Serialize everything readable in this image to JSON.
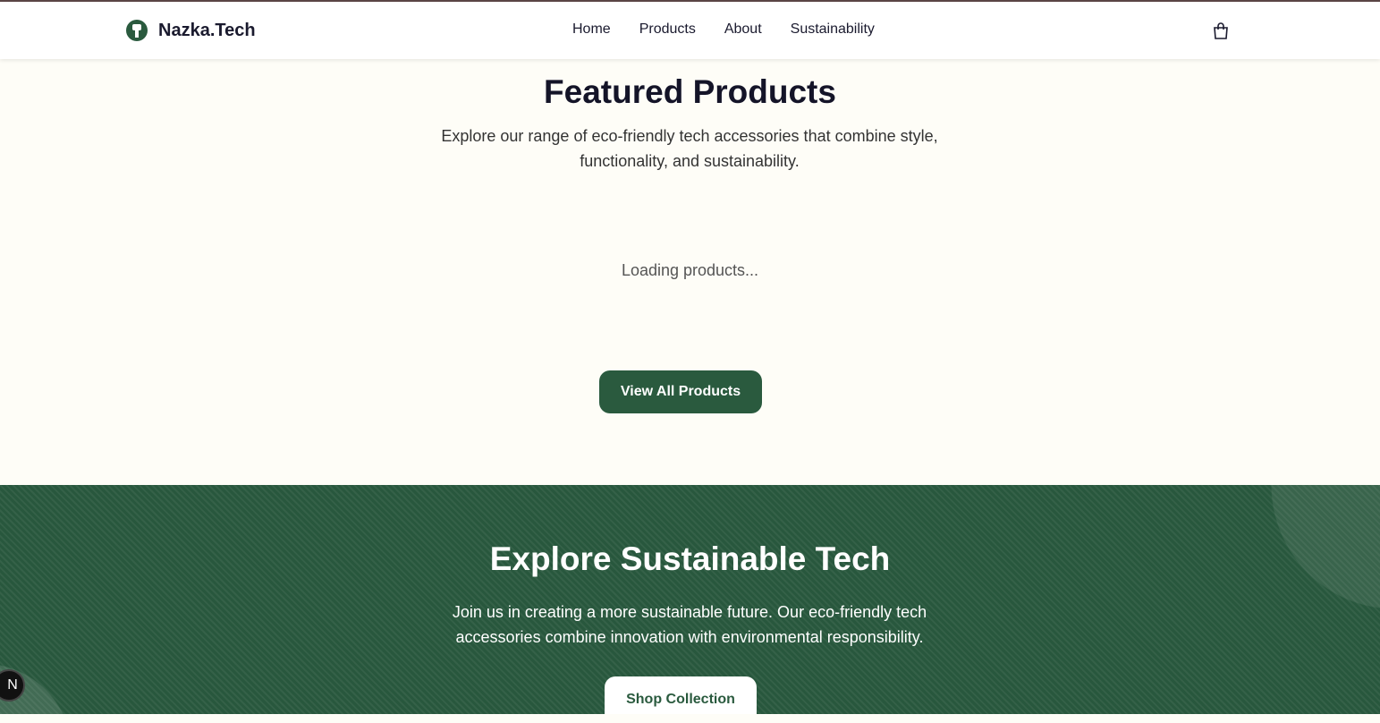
{
  "header": {
    "brand": "Nazka.Tech",
    "nav": [
      "Home",
      "Products",
      "About",
      "Sustainability"
    ]
  },
  "featured": {
    "title": "Featured Products",
    "subtitle": "Explore our range of eco-friendly tech accessories that combine style, functionality, and sustainability.",
    "loading": "Loading products...",
    "button": "View All Products"
  },
  "cta": {
    "title": "Explore Sustainable Tech",
    "subtitle": "Join us in creating a more sustainable future. Our eco-friendly tech accessories combine innovation with environmental responsibility.",
    "button": "Shop Collection"
  },
  "dev_badge": "N",
  "colors": {
    "brand_green": "#2a5a3e",
    "background": "#fefdf7"
  }
}
